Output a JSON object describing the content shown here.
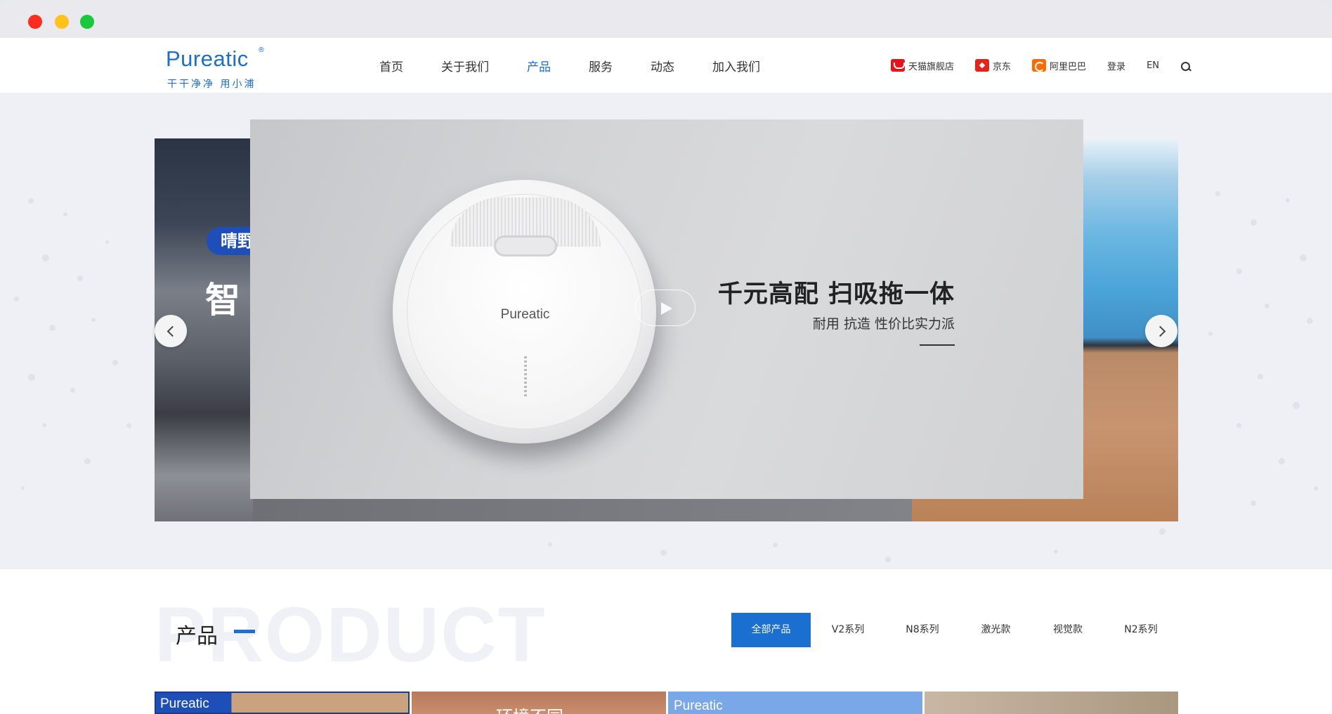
{
  "header": {
    "logo": {
      "word": "Pureatic",
      "reg": "®",
      "slogan": "干干净净 用小浦"
    },
    "nav": [
      "首页",
      "关于我们",
      "产品",
      "服务",
      "动态",
      "加入我们"
    ],
    "nav_active": 2,
    "shops": [
      {
        "label": "天猫旗舰店",
        "icon": "tmall-icon"
      },
      {
        "label": "京东",
        "icon": "jd-icon"
      },
      {
        "label": "阿里巴巴",
        "icon": "alibaba-icon"
      }
    ],
    "login_label": "登录",
    "lang_label": "EN",
    "search_icon": "search-icon"
  },
  "hero": {
    "left_tag": "晴野",
    "left_big": "智",
    "robot_brand": "Pureatic",
    "title": "千元高配 扫吸拖一体",
    "subtitle": "耐用 抗造 性价比实力派"
  },
  "products": {
    "watermark": "PRODUCT",
    "title": "产品",
    "tabs": [
      "全部产品",
      "V2系列",
      "N8系列",
      "激光款",
      "视觉款",
      "N2系列"
    ],
    "tab_active": 0,
    "cards": [
      "Pureatic",
      "环境不同",
      "Pureatic",
      ""
    ]
  },
  "colors": {
    "accent": "#1a6fd1",
    "traffic_red": "#ff2d20",
    "traffic_yellow": "#ffc21a",
    "traffic_green": "#19c93b"
  }
}
